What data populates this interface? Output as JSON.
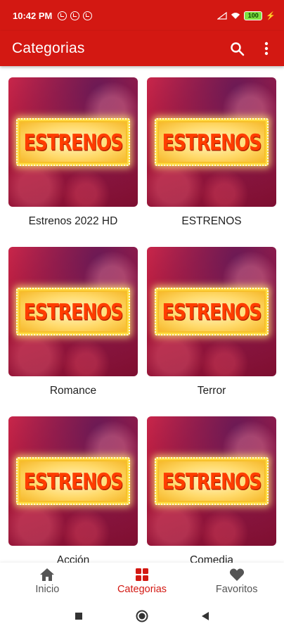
{
  "status_bar": {
    "time": "10:42 PM",
    "battery": "100"
  },
  "app_bar": {
    "title": "Categorias"
  },
  "categories": [
    {
      "label": "Estrenos 2022 HD",
      "poster_text": "ESTRENOS"
    },
    {
      "label": "ESTRENOS",
      "poster_text": "ESTRENOS"
    },
    {
      "label": "Romance",
      "poster_text": "ESTRENOS"
    },
    {
      "label": "Terror",
      "poster_text": "ESTRENOS"
    },
    {
      "label": "Acción",
      "poster_text": "ESTRENOS"
    },
    {
      "label": "Comedia",
      "poster_text": "ESTRENOS"
    }
  ],
  "bottom_nav": {
    "items": [
      {
        "label": "Inicio",
        "icon": "home-icon",
        "active": false
      },
      {
        "label": "Categorias",
        "icon": "grid-icon",
        "active": true
      },
      {
        "label": "Favoritos",
        "icon": "heart-icon",
        "active": false
      }
    ]
  },
  "colors": {
    "primary": "#d31812",
    "active_nav": "#d31812",
    "inactive_nav": "#555555"
  }
}
